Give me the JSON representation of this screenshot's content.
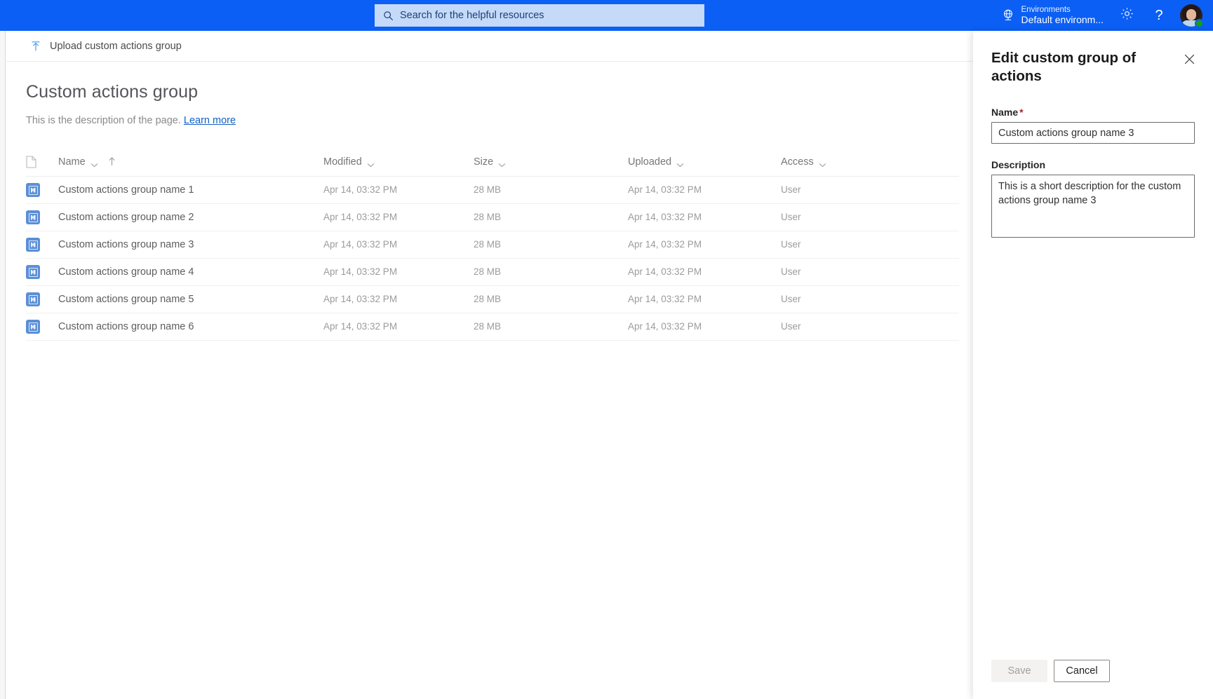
{
  "suitebar": {
    "search": {
      "icon": "search-icon",
      "placeholder": "Search for the helpful resources"
    },
    "environment": {
      "icon": "environment-globe-icon",
      "label": "Environments",
      "value": "Default environm..."
    },
    "settings": {
      "icon": "gear-icon",
      "label": "Settings"
    },
    "help": {
      "icon": "question-mark-icon",
      "label": "Help"
    },
    "avatar": {
      "icon": "avatar-icon",
      "presence": "available"
    },
    "accent_color": "#0b5ff5",
    "search_bg_color": "#c5daf8"
  },
  "commandbar": {
    "upload": {
      "icon": "upload-icon",
      "label": "Upload custom actions group"
    }
  },
  "page": {
    "title": "Custom actions group",
    "description": "This is the description of the page.",
    "learn_more": "Learn more"
  },
  "list": {
    "columns": [
      {
        "key": "select",
        "label": "",
        "icon": "document-icon",
        "sortable": false
      },
      {
        "key": "name",
        "label": "Name",
        "sortable": true,
        "sorted": "ascending",
        "sort_icon": "arrow-up-icon"
      },
      {
        "key": "modified",
        "label": "Modified",
        "sortable": true
      },
      {
        "key": "size",
        "label": "Size",
        "sortable": true
      },
      {
        "key": "uploaded",
        "label": "Uploaded",
        "sortable": true
      },
      {
        "key": "access",
        "label": "Access",
        "sortable": true
      }
    ],
    "rows": [
      {
        "icon": "custom-action-group-icon",
        "name": "Custom actions group name 1",
        "modified": "Apr 14, 03:32 PM",
        "size": "28 MB",
        "uploaded": "Apr 14, 03:32 PM",
        "access": "User"
      },
      {
        "icon": "custom-action-group-icon",
        "name": "Custom actions group name 2",
        "modified": "Apr 14, 03:32 PM",
        "size": "28 MB",
        "uploaded": "Apr 14, 03:32 PM",
        "access": "User"
      },
      {
        "icon": "custom-action-group-icon",
        "name": "Custom actions group name 3",
        "modified": "Apr 14, 03:32 PM",
        "size": "28 MB",
        "uploaded": "Apr 14, 03:32 PM",
        "access": "User"
      },
      {
        "icon": "custom-action-group-icon",
        "name": "Custom actions group name 4",
        "modified": "Apr 14, 03:32 PM",
        "size": "28 MB",
        "uploaded": "Apr 14, 03:32 PM",
        "access": "User"
      },
      {
        "icon": "custom-action-group-icon",
        "name": "Custom actions group name 5",
        "modified": "Apr 14, 03:32 PM",
        "size": "28 MB",
        "uploaded": "Apr 14, 03:32 PM",
        "access": "User"
      },
      {
        "icon": "custom-action-group-icon",
        "name": "Custom actions group name 6",
        "modified": "Apr 14, 03:32 PM",
        "size": "28 MB",
        "uploaded": "Apr 14, 03:32 PM",
        "access": "User"
      }
    ]
  },
  "panel": {
    "title": "Edit custom group of actions",
    "close": {
      "icon": "close-icon",
      "label": "Close"
    },
    "name_field": {
      "label": "Name",
      "required_marker": "*",
      "value": "Custom actions group name 3"
    },
    "description_field": {
      "label": "Description",
      "value": "This is a short description for the custom actions group name 3"
    },
    "save_label": "Save",
    "cancel_label": "Cancel",
    "save_disabled": true,
    "required_color": "#a4262c"
  }
}
